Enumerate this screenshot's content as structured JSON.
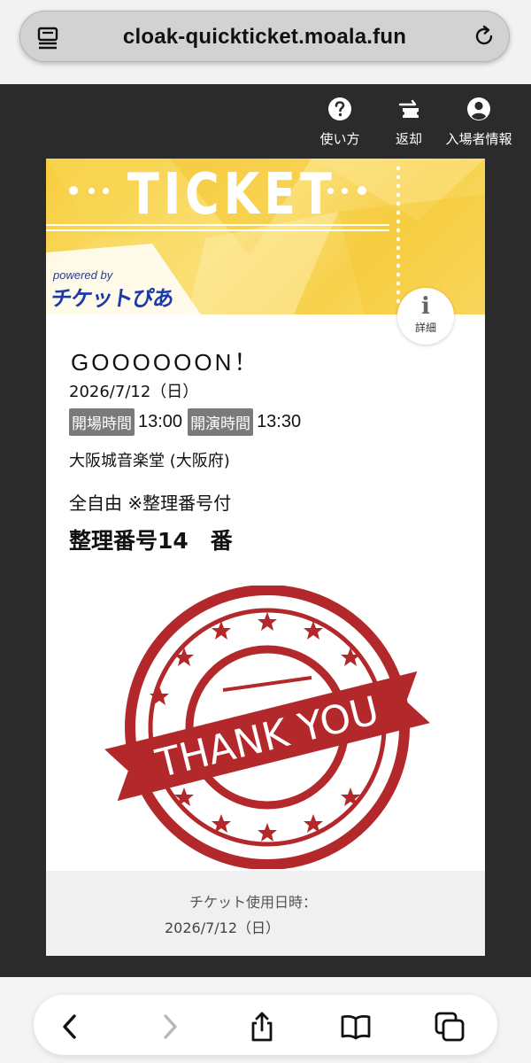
{
  "browser": {
    "url": "cloak-quickticket.moala.fun"
  },
  "nav": {
    "help_label": "使い方",
    "return_label": "返却",
    "entrant_label": "入場者情報"
  },
  "ticket": {
    "banner_word": "TICKET",
    "powered_by": "powered by",
    "brand": "チケットぴあ",
    "detail_label": "詳細",
    "event_title": "GOOOOOON！",
    "date": "2026/7/12（日）",
    "open_label": "開場時間",
    "open_time": "13:00",
    "start_label": "開演時間",
    "start_time": "13:30",
    "venue": "大阪城音楽堂 (大阪府)",
    "seat_type": "全自由 ※整理番号付",
    "seat_number": "整理番号14　番",
    "stamp_text": "THANK YOU",
    "usage_label": "チケット使用日時：",
    "usage_date": "2026/7/12（日）"
  },
  "colors": {
    "banner_yellow": "#f6cd3c",
    "stamp_red": "#b3282b",
    "badge_gray": "#7a7a7a",
    "dark_bg": "#2b2b2b"
  },
  "icons": {
    "url_left": "page-menu-icon",
    "url_right": "reload-icon",
    "help": "question-circle-icon",
    "return": "ticket-return-icon",
    "entrant": "user-circle-icon",
    "back": "chevron-left-icon",
    "forward": "chevron-right-icon",
    "share": "share-icon",
    "bookmarks": "book-icon",
    "tabs": "tabs-icon"
  }
}
